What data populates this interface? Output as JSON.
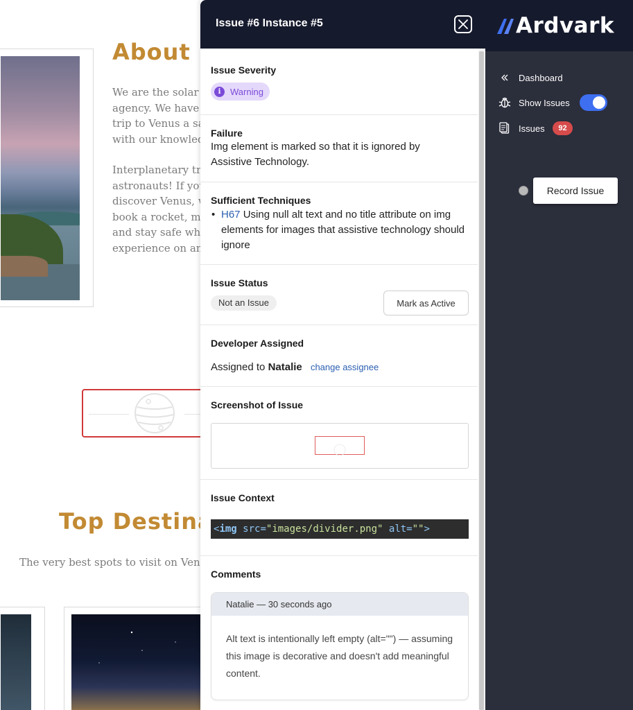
{
  "website": {
    "about_title": "About U",
    "about_paragraphs": [
      [
        "We are the solar sy",
        "agency. We have th",
        "trip to Venus a safe",
        "with our knowledg"
      ],
      [
        "Interplanetary trav",
        "astronauts! If you",
        "discover Venus, we",
        "book a rocket, mak",
        "and stay safe while",
        "experience on and"
      ]
    ],
    "destinations_title": "Top Destinat",
    "destinations_subtitle": "The very best spots to visit on Venus,"
  },
  "drawer": {
    "title": "Issue #6 Instance #5",
    "severity": {
      "heading": "Issue Severity",
      "badge_icon": "i",
      "label": "Warning",
      "color": "#7b4bd8"
    },
    "failure": {
      "heading": "Failure",
      "text": "Img element is marked so that it is ignored by Assistive Technology."
    },
    "techniques": {
      "heading": "Sufficient Techniques",
      "items": [
        {
          "code": "H67",
          "text": " Using null alt text and no title attribute on img elements for images that assistive technology should ignore"
        }
      ]
    },
    "status": {
      "heading": "Issue Status",
      "value": "Not an Issue",
      "action_label": "Mark as Active"
    },
    "developer": {
      "heading": "Developer Assigned",
      "prefix": "Assigned to ",
      "name": "Natalie",
      "change_label": "change assignee"
    },
    "screenshot": {
      "heading": "Screenshot of Issue"
    },
    "context": {
      "heading": "Issue Context",
      "code": {
        "open": "<",
        "tag": "img",
        "attr1": " src=",
        "val1": "\"images/divider.png\"",
        "attr2": " alt=",
        "val2": "\"\"",
        "close": ">"
      }
    },
    "comments": {
      "heading": "Comments",
      "items": [
        {
          "author": "Natalie",
          "separator": " — ",
          "time": "30 seconds ago",
          "body": "Alt text is intentionally left empty (alt=\"\") — assuming this image is decorative and doesn't add meaningful content."
        }
      ]
    }
  },
  "sidebar": {
    "brand": "Ardvark",
    "items": {
      "dashboard": {
        "label": "Dashboard",
        "icon": "double-chevron-left-icon"
      },
      "show_issues": {
        "label": "Show Issues",
        "icon": "bug-icon",
        "toggle_on": true
      },
      "issues": {
        "label": "Issues",
        "icon": "clipboard-icon",
        "count": "92"
      }
    },
    "record_label": "Record Issue",
    "accent": "#3d6ff0",
    "alert": "#d64b4b"
  }
}
